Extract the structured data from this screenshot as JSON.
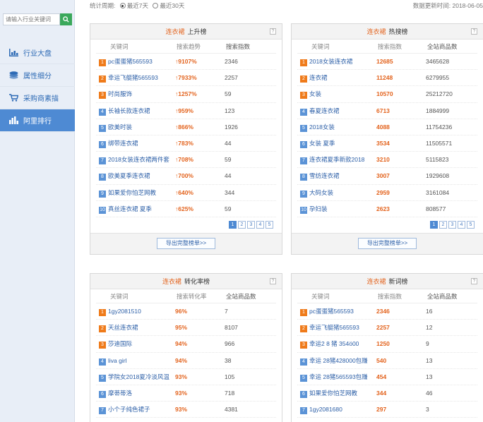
{
  "sidebar": {
    "search_placeholder": "请输入行业关键词",
    "items": [
      {
        "label": "行业大盘",
        "icon": "chart-icon"
      },
      {
        "label": "属性细分",
        "icon": "layers-icon"
      },
      {
        "label": "采购商素描",
        "icon": "cart-icon"
      },
      {
        "label": "阿里排行",
        "icon": "bar-chart-icon",
        "active": true
      }
    ]
  },
  "topbar": {
    "period_label": "统计周期:",
    "option_7": "最近7天",
    "option_30": "最近30天",
    "updated": "数据更新时间: 2018-06-05"
  },
  "panels": {
    "rising": {
      "category": "连衣裙",
      "title": "上升榜",
      "headers": [
        "关键词",
        "搜索趋势",
        "搜索指数"
      ],
      "rows": [
        {
          "rank": "1",
          "kw": "pc蛋蛋猪565593",
          "v2": "9107%",
          "v3": "2346"
        },
        {
          "rank": "2",
          "kw": "幸运飞艇猪565593",
          "v2": "7933%",
          "v3": "2257"
        },
        {
          "rank": "3",
          "kw": "时尚服饰",
          "v2": "1257%",
          "v3": "59"
        },
        {
          "rank": "4",
          "kw": "长袖长款连衣裙",
          "v2": "959%",
          "v3": "123"
        },
        {
          "rank": "5",
          "kw": "欧美时装",
          "v2": "866%",
          "v3": "1926"
        },
        {
          "rank": "6",
          "kw": "绑带连衣裙",
          "v2": "783%",
          "v3": "44"
        },
        {
          "rank": "7",
          "kw": "2018女装连衣裙两件套",
          "v2": "708%",
          "v3": "59"
        },
        {
          "rank": "8",
          "kw": "欧美夏季连衣裙",
          "v2": "700%",
          "v3": "44"
        },
        {
          "rank": "9",
          "kw": "如果爱你怕芝网教",
          "v2": "640%",
          "v3": "344"
        },
        {
          "rank": "10",
          "kw": "真丝连衣裙 夏季",
          "v2": "625%",
          "v3": "59"
        }
      ],
      "pages": [
        "1",
        "2",
        "3",
        "4",
        "5"
      ],
      "export": "导出完整榜单>>"
    },
    "hot": {
      "category": "连衣裙",
      "title": "热搜榜",
      "headers": [
        "关键词",
        "搜索指数",
        "全站商品数"
      ],
      "rows": [
        {
          "rank": "1",
          "kw": "2018女装连衣裙",
          "v2": "12685",
          "v3": "3465628"
        },
        {
          "rank": "2",
          "kw": "连衣裙",
          "v2": "11248",
          "v3": "6279955"
        },
        {
          "rank": "3",
          "kw": "女装",
          "v2": "10570",
          "v3": "25212720"
        },
        {
          "rank": "4",
          "kw": "春夏连衣裙",
          "v2": "6713",
          "v3": "1884999"
        },
        {
          "rank": "5",
          "kw": "2018女装",
          "v2": "4088",
          "v3": "11754236"
        },
        {
          "rank": "6",
          "kw": "女装 夏季",
          "v2": "3534",
          "v3": "11505571"
        },
        {
          "rank": "7",
          "kw": "连衣裙夏季新款2018",
          "v2": "3210",
          "v3": "5115823"
        },
        {
          "rank": "8",
          "kw": "雪纺连衣裙",
          "v2": "3007",
          "v3": "1929608"
        },
        {
          "rank": "9",
          "kw": "大码女装",
          "v2": "2959",
          "v3": "3161084"
        },
        {
          "rank": "10",
          "kw": "孕妇装",
          "v2": "2623",
          "v3": "808577"
        }
      ],
      "pages": [
        "1",
        "2",
        "3",
        "4",
        "5"
      ],
      "export": "导出完整榜单>>"
    },
    "conversion": {
      "category": "连衣裙",
      "title": "转化率榜",
      "headers": [
        "关键词",
        "搜索转化率",
        "全站商品数"
      ],
      "rows": [
        {
          "rank": "1",
          "kw": "1gy2081510",
          "v2": "96%",
          "v3": "7"
        },
        {
          "rank": "2",
          "kw": "天丝连衣裙",
          "v2": "95%",
          "v3": "8107"
        },
        {
          "rank": "3",
          "kw": "莎迪国际",
          "v2": "94%",
          "v3": "966"
        },
        {
          "rank": "4",
          "kw": "liva girl",
          "v2": "94%",
          "v3": "38"
        },
        {
          "rank": "5",
          "kw": "学院女2018夏冷淡风温",
          "v2": "93%",
          "v3": "105"
        },
        {
          "rank": "6",
          "kw": "摩蒂蒂洛",
          "v2": "93%",
          "v3": "718"
        },
        {
          "rank": "7",
          "kw": "小个子纯色裙子",
          "v2": "93%",
          "v3": "4381"
        }
      ]
    },
    "new": {
      "category": "连衣裙",
      "title": "新词榜",
      "headers": [
        "关键词",
        "搜索指数",
        "全站商品数"
      ],
      "rows": [
        {
          "rank": "1",
          "kw": "pc蛋蛋猪565593",
          "v2": "2346",
          "v3": "16"
        },
        {
          "rank": "2",
          "kw": "幸运飞艇猪565593",
          "v2": "2257",
          "v3": "12"
        },
        {
          "rank": "3",
          "kw": "幸运2 8 猪 354ö00",
          "v2": "1250",
          "v3": "9"
        },
        {
          "rank": "4",
          "kw": "幸运 28猪428000包赚",
          "v2": "540",
          "v3": "13"
        },
        {
          "rank": "5",
          "kw": "幸运 28猪565593包赚",
          "v2": "454",
          "v3": "13"
        },
        {
          "rank": "6",
          "kw": "如果爱你怕芝网教",
          "v2": "344",
          "v3": "46"
        },
        {
          "rank": "7",
          "kw": "1gy2081680",
          "v2": "297",
          "v3": "3"
        }
      ]
    }
  },
  "colors": {
    "accent": "#e3631d",
    "link": "#2c5fa7",
    "nav_active": "#4e8ad3",
    "rank_top": "#ef7b1b",
    "rank_low": "#5b93d6"
  }
}
